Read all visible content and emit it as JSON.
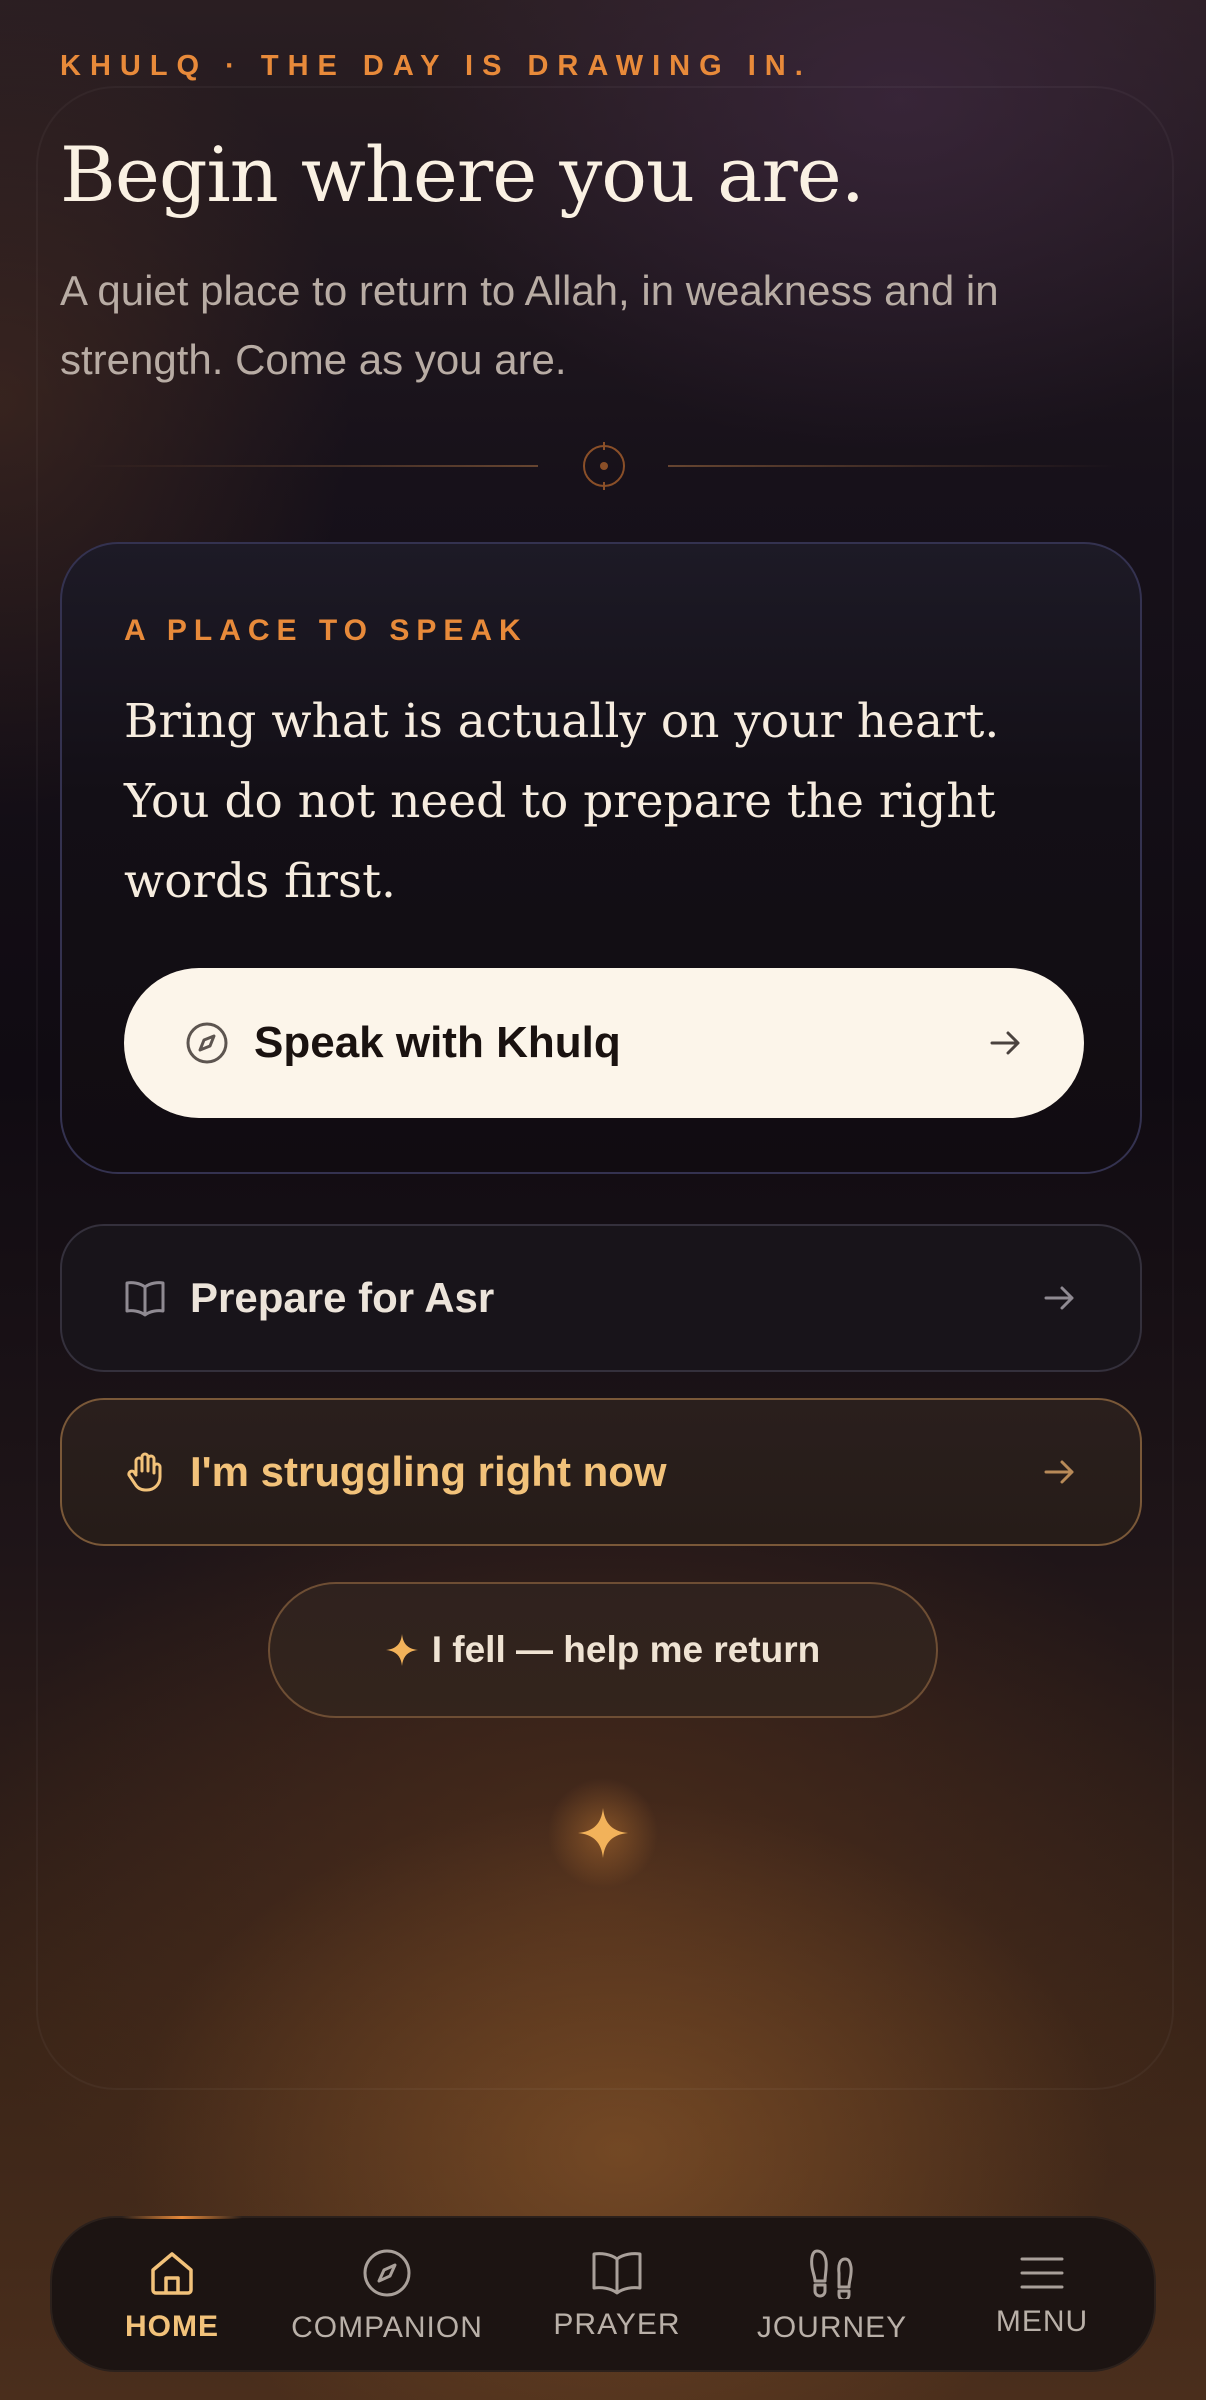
{
  "header": {
    "eyebrow": "KHULQ · THE DAY IS DRAWING IN.",
    "title": "Begin where you are.",
    "subtitle": "A quiet place to return to Allah, in weakness and in strength. Come as you are."
  },
  "speak_card": {
    "kicker": "A PLACE TO SPEAK",
    "body": "Bring what is actually on your heart. You do not need to prepare the right words first.",
    "button_label": "Speak with Khulq"
  },
  "actions": {
    "prepare_label": "Prepare for Asr",
    "struggling_label": "I'm struggling right now",
    "fell_label": "I fell — help me return"
  },
  "nav": {
    "items": [
      {
        "label": "HOME",
        "icon": "home-icon",
        "active": true
      },
      {
        "label": "COMPANION",
        "icon": "compass-icon",
        "active": false
      },
      {
        "label": "PRAYER",
        "icon": "book-icon",
        "active": false
      },
      {
        "label": "JOURNEY",
        "icon": "footprints-icon",
        "active": false
      },
      {
        "label": "MENU",
        "icon": "menu-icon",
        "active": false
      }
    ]
  },
  "colors": {
    "accent": "#e88a3a",
    "gold": "#f2c27a",
    "cream": "#fcf5ea"
  }
}
